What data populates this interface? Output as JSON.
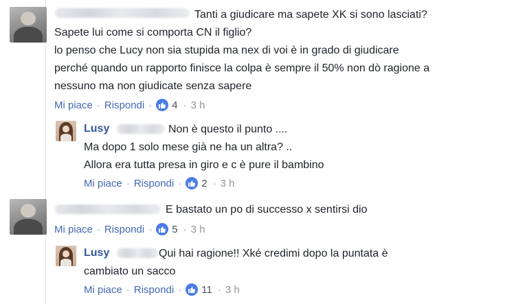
{
  "comments": [
    {
      "author": "",
      "lines": [
        "Tanti a giudicare ma sapete XK si sono lasciati?",
        "Sapete lui come si comporta CN il figlio?",
        "lo penso che Lucy non sia stupida ma nex di voi è in grado di giudicare",
        "perché quando un rapporto finisce la colpa è sempre il 50% non dò ragione a",
        "nessuno ma non giudicate senza sapere"
      ],
      "like_label": "Mi piace",
      "reply_label": "Rispondi",
      "reactions": "4",
      "time": "3 h",
      "replies": [
        {
          "author": "Lusy",
          "lines": [
            "Non è questo il punto ....",
            "Ma dopo 1 solo mese già ne ha un altra? ..",
            "Allora era tutta presa in giro e c è pure il bambino"
          ],
          "like_label": "Mi piace",
          "reply_label": "Rispondi",
          "reactions": "2",
          "time": "3 h"
        }
      ]
    },
    {
      "author": "",
      "lines": [
        "E bastato un po di successo x sentirsi dio"
      ],
      "like_label": "Mi piace",
      "reply_label": "Rispondi",
      "reactions": "5",
      "time": "3 h",
      "replies": [
        {
          "author": "Lusy",
          "lines": [
            "Qui hai ragione!! Xké credimi dopo la puntata è",
            "cambiato un sacco"
          ],
          "like_label": "Mi piace",
          "reply_label": "Rispondi",
          "reactions": "11",
          "time": "3 h"
        }
      ]
    }
  ],
  "separator": "·",
  "colors": {
    "link": "#4267b2",
    "author": "#365899",
    "like_badge": "#4a7ce8",
    "meta": "#90949c"
  },
  "icons": {
    "reaction": "thumbs-up-icon"
  }
}
